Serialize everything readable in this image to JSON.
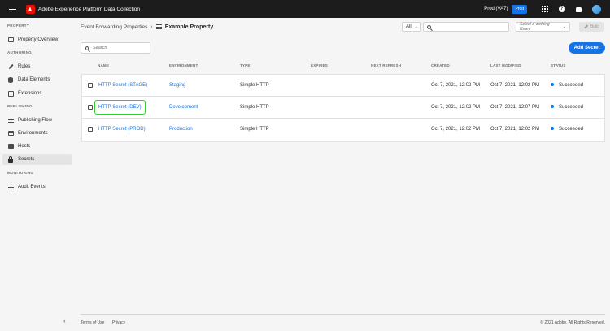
{
  "app": {
    "title": "Adobe Experience Platform Data Collection",
    "org": "Prod (VA7)",
    "env_badge": "Prod"
  },
  "sidebar": {
    "sections": [
      {
        "label": "PROPERTY"
      },
      {
        "label": "AUTHORING"
      },
      {
        "label": "PUBLISHING"
      },
      {
        "label": "MONITORING"
      }
    ],
    "items": [
      {
        "label": "Property Overview"
      },
      {
        "label": "Rules"
      },
      {
        "label": "Data Elements"
      },
      {
        "label": "Extensions"
      },
      {
        "label": "Publishing Flow"
      },
      {
        "label": "Environments"
      },
      {
        "label": "Hosts"
      },
      {
        "label": "Secrets"
      },
      {
        "label": "Audit Events"
      }
    ]
  },
  "breadcrumb": {
    "parent": "Event Forwarding Properties",
    "current": "Example Property"
  },
  "toolbar": {
    "scope": "All",
    "library_placeholder": "Select a working library",
    "build_label": "Build"
  },
  "search": {
    "placeholder": "Search"
  },
  "add_secret_label": "Add Secret",
  "table": {
    "columns": [
      "NAME",
      "ENVIRONMENT",
      "TYPE",
      "EXPIRES",
      "NEXT REFRESH",
      "CREATED",
      "LAST MODIFIED",
      "STATUS"
    ],
    "rows": [
      {
        "name": "HTTP Secret (STAGE)",
        "environment": "Staging",
        "type": "Simple HTTP",
        "expires": "",
        "next_refresh": "",
        "created": "Oct 7, 2021, 12:02 PM",
        "modified": "Oct 7, 2021, 12:02 PM",
        "status": "Succeeded"
      },
      {
        "name": "HTTP Secret (DEV)",
        "environment": "Development",
        "type": "Simple HTTP",
        "expires": "",
        "next_refresh": "",
        "created": "Oct 7, 2021, 12:02 PM",
        "modified": "Oct 7, 2021, 12:07 PM",
        "status": "Succeeded"
      },
      {
        "name": "HTTP Secret (PROD)",
        "environment": "Production",
        "type": "Simple HTTP",
        "expires": "",
        "next_refresh": "",
        "created": "Oct 7, 2021, 12:02 PM",
        "modified": "Oct 7, 2021, 12:02 PM",
        "status": "Succeeded"
      }
    ]
  },
  "footer": {
    "terms": "Terms of Use",
    "privacy": "Privacy",
    "copyright": "© 2021 Adobe. All Rights Reserved."
  },
  "colors": {
    "accent": "#1473e6",
    "highlight": "#2fd12f",
    "topbar": "#1c1c1c",
    "logo": "#eb1000"
  }
}
